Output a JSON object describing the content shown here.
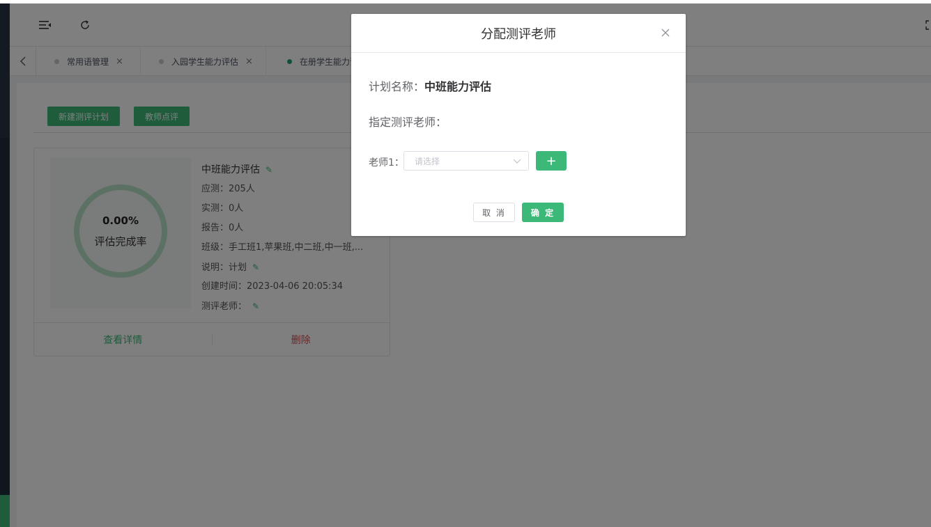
{
  "tabs": [
    {
      "label": "常用语管理",
      "active": false
    },
    {
      "label": "入园学生能力评估",
      "active": false
    },
    {
      "label": "在册学生能力评估",
      "active": true
    }
  ],
  "toolbar": {
    "new_plan": "新建测评计划",
    "teacher_review": "教师点评"
  },
  "card": {
    "completion_pct": "0.00%",
    "completion_label": "评估完成率",
    "title": "中班能力评估",
    "should_test": "应测：205人",
    "actual_test": "实测：0人",
    "report": "报告：0人",
    "classes": "班级：手工班1,苹果班,中二班,中一班,...",
    "note": "说明：计划",
    "created": "创建时间：2023-04-06 20:05:34",
    "assessor": "测评老师：",
    "view_details": "查看详情",
    "delete": "删除"
  },
  "dialog": {
    "title": "分配测评老师",
    "plan_name_label": "计划名称：",
    "plan_name_value": "中班能力评估",
    "assign_label": "指定测评老师：",
    "teacher1_label": "老师1：",
    "select_placeholder": "请选择",
    "add_label": "+",
    "cancel": "取 消",
    "confirm": "确 定"
  },
  "colors": {
    "accent": "#3cb878",
    "danger": "#e04b4b"
  }
}
